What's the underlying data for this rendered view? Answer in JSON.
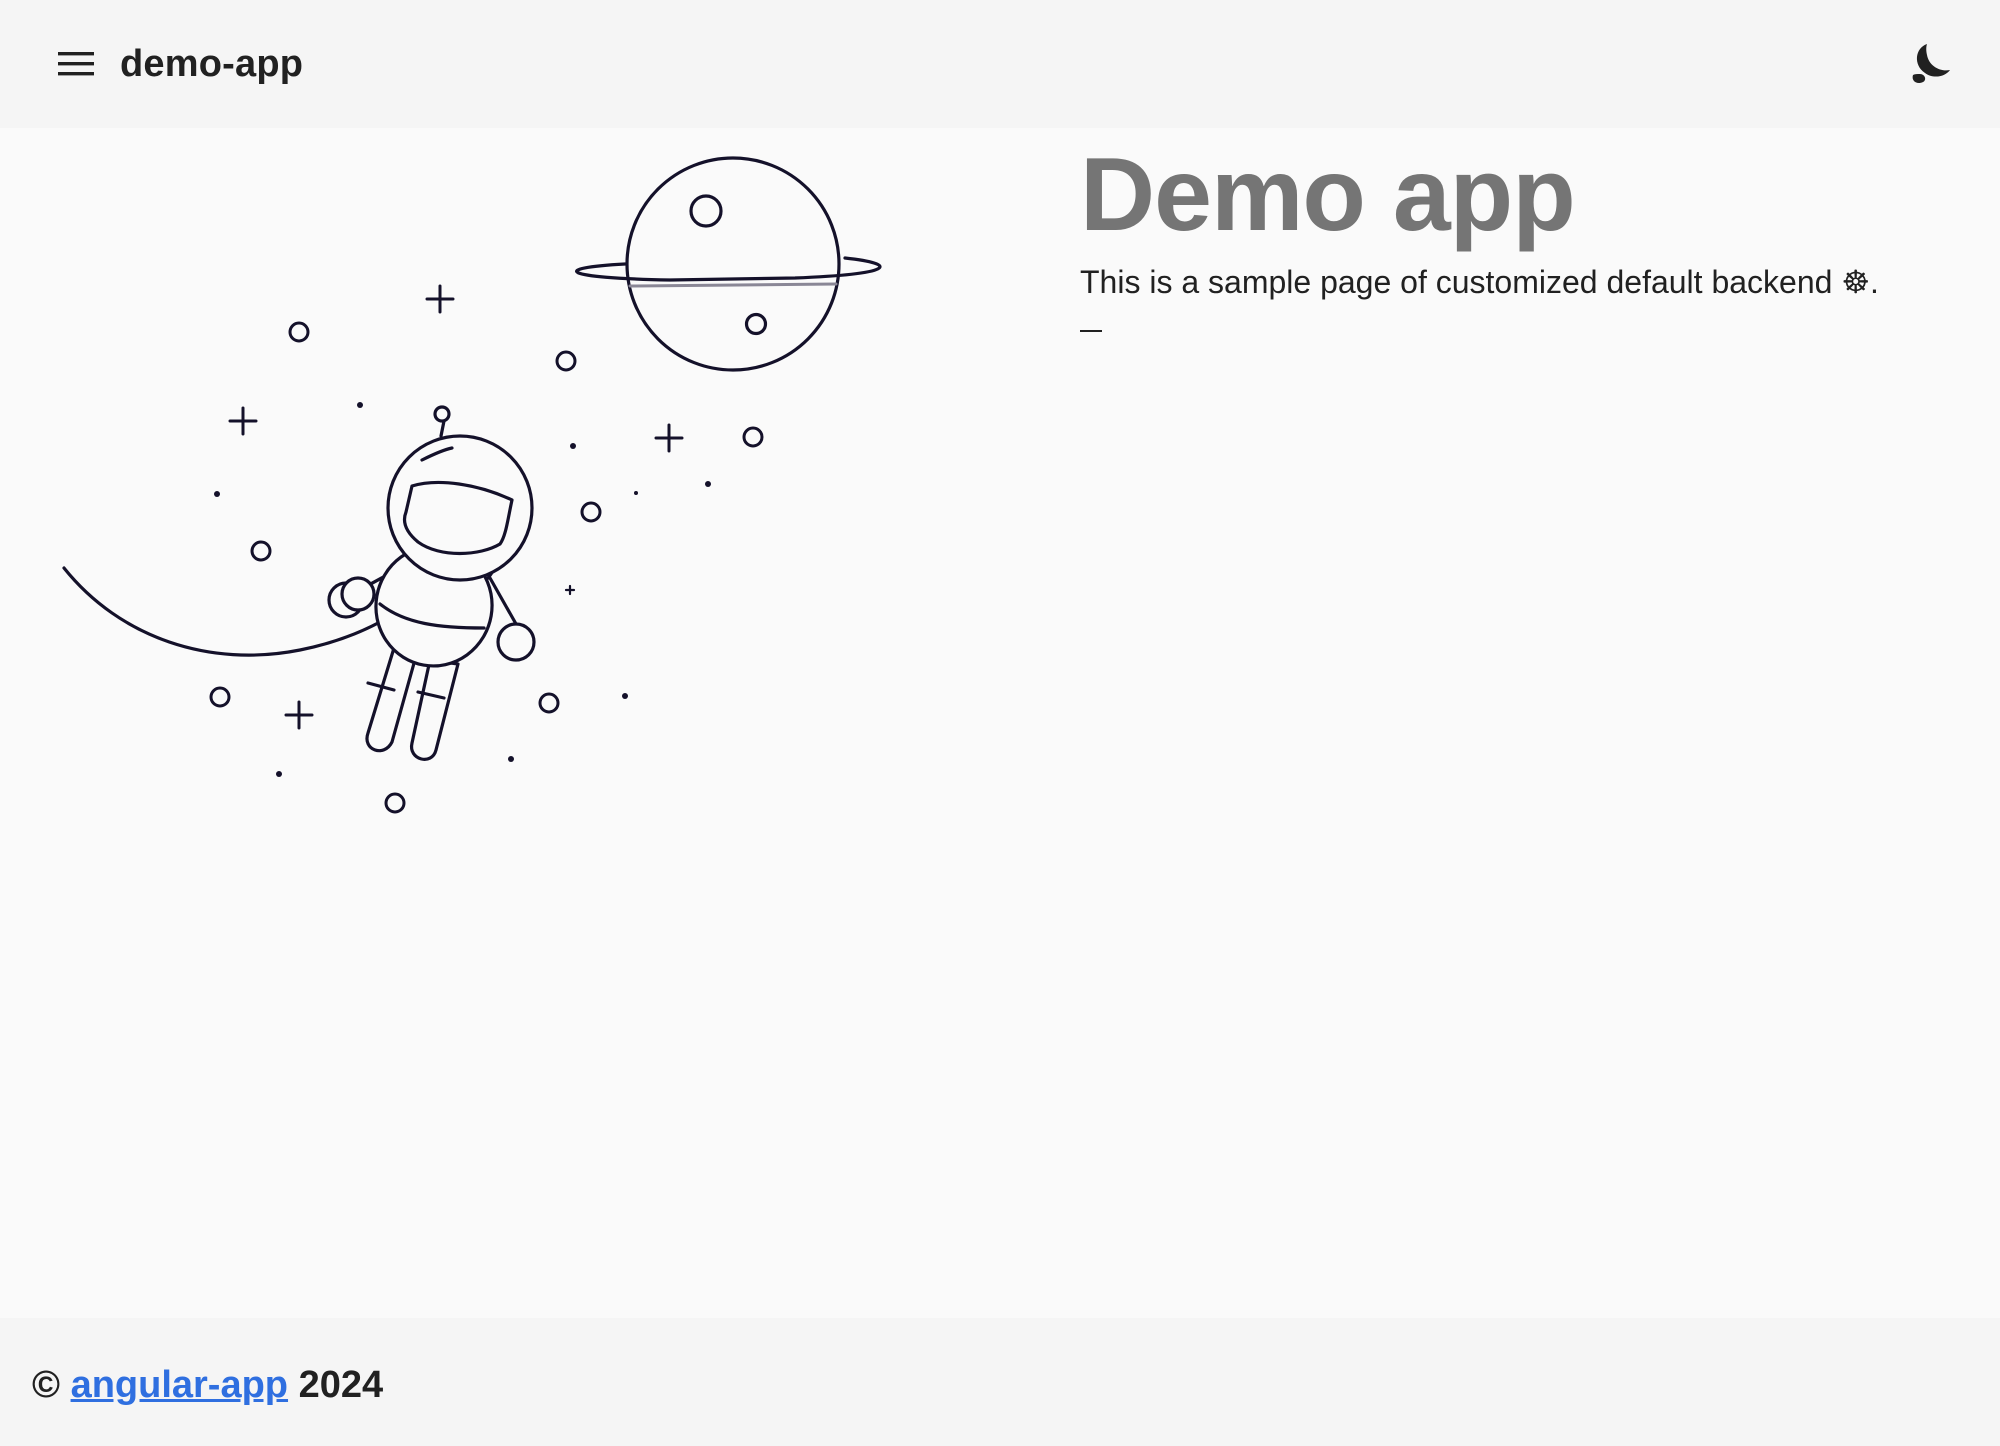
{
  "header": {
    "title": "demo-app",
    "menu_icon": "menu-icon",
    "theme_icon": "dark-mode-moon-icon"
  },
  "hero": {
    "title": "Demo app",
    "description": "This is a sample page of customized default backend ☸.",
    "dash": "—"
  },
  "illustration": {
    "name": "astronaut-space-illustration"
  },
  "footer": {
    "copyright": "©",
    "link_label": "angular-app",
    "year": "2024"
  },
  "colors": {
    "toolbar_bg": "#f5f5f5",
    "page_bg": "#fafafa",
    "hero_title": "#757575",
    "link": "#2f6fe0",
    "text": "#212121",
    "line_art": "#14112a"
  }
}
